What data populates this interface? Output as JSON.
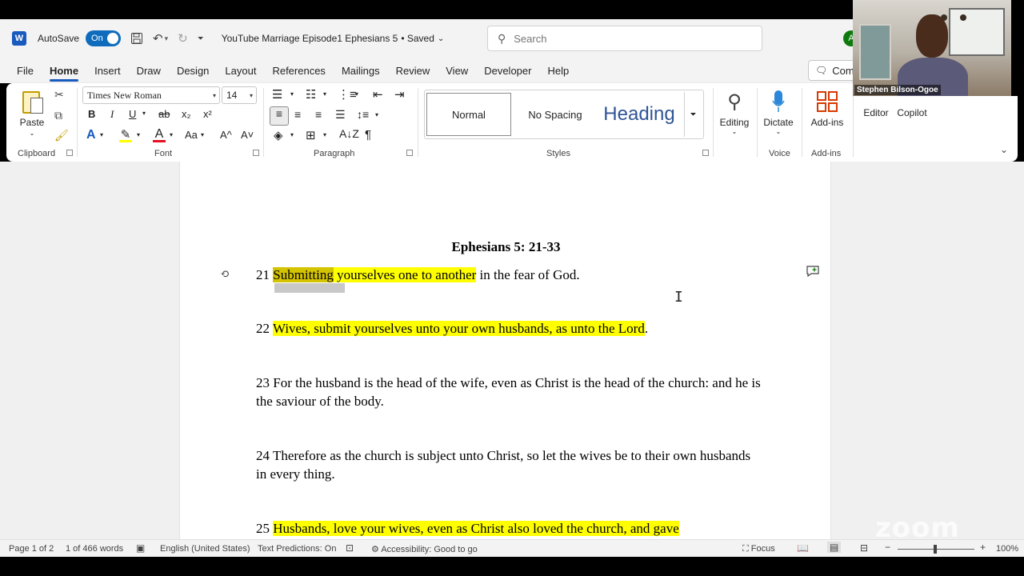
{
  "titlebar": {
    "app_logo": "word-logo-icon",
    "autosave_label": "AutoSave",
    "autosave_state": "On",
    "doc_title": "YouTube Marriage Episode1 Ephesians 5",
    "doc_status": "• Saved",
    "search_placeholder": "Search",
    "avatar_initial": "A"
  },
  "tabs": [
    "File",
    "Home",
    "Insert",
    "Draw",
    "Design",
    "Layout",
    "References",
    "Mailings",
    "Review",
    "View",
    "Developer",
    "Help"
  ],
  "active_tab": "Home",
  "comments_label": "Comm",
  "ribbon": {
    "clipboard": {
      "paste_label": "Paste",
      "group_label": "Clipboard"
    },
    "font": {
      "font_name": "Times New Roman",
      "font_size": "14",
      "bold": "B",
      "italic": "I",
      "underline": "U",
      "strike": "ab",
      "subscript": "x₂",
      "superscript": "x²",
      "text_effects": "A",
      "font_color": "A",
      "change_case": "Aa",
      "grow": "A^",
      "shrink": "A˅",
      "group_label": "Font",
      "highlight_color": "#ffff00",
      "font_color_value": "#e81123"
    },
    "paragraph": {
      "group_label": "Paragraph",
      "pilcrow": "¶"
    },
    "styles": {
      "normal": "Normal",
      "no_spacing": "No Spacing",
      "heading": "Heading",
      "group_label": "Styles"
    },
    "editing": {
      "label": "Editing"
    },
    "voice": {
      "dictate_label": "Dictate",
      "group_label": "Voice"
    },
    "addins": {
      "label": "Add-ins",
      "group_label": "Add-ins"
    },
    "editor_label": "Editor",
    "copilot_label": "Copilot"
  },
  "document": {
    "heading": "Ephesians 5: 21-33",
    "verses": {
      "v21": {
        "num": "21 ",
        "sel": "Submitting",
        "hl": " yourselves one to another",
        "rest": " in the fear of God."
      },
      "v22": {
        "num": "22 ",
        "hl": "Wives, submit yourselves unto your own husbands, as unto the Lord",
        "rest": "."
      },
      "v23": {
        "text": "23 For the husband is the head of the wife, even as Christ is the head of the church: and he is the saviour of the body."
      },
      "v24": {
        "text": "24 Therefore as the church is subject unto Christ, so let the wives be to their own husbands in every thing."
      },
      "v25": {
        "num": "25 ",
        "hl": "Husbands, love your wives, even as Christ also loved the church, and gave"
      }
    },
    "highlight_color": "#ffff00"
  },
  "statusbar": {
    "page": "Page 1 of 2",
    "words": "1 of 466 words",
    "language": "English (United States)",
    "text_predictions": "Text Predictions: On",
    "accessibility": "Accessibility: Good to go",
    "focus": "Focus",
    "zoom": "100%"
  },
  "video": {
    "participant_name": "Stephen Bilson-Ogoe",
    "watermark": "zoom"
  }
}
